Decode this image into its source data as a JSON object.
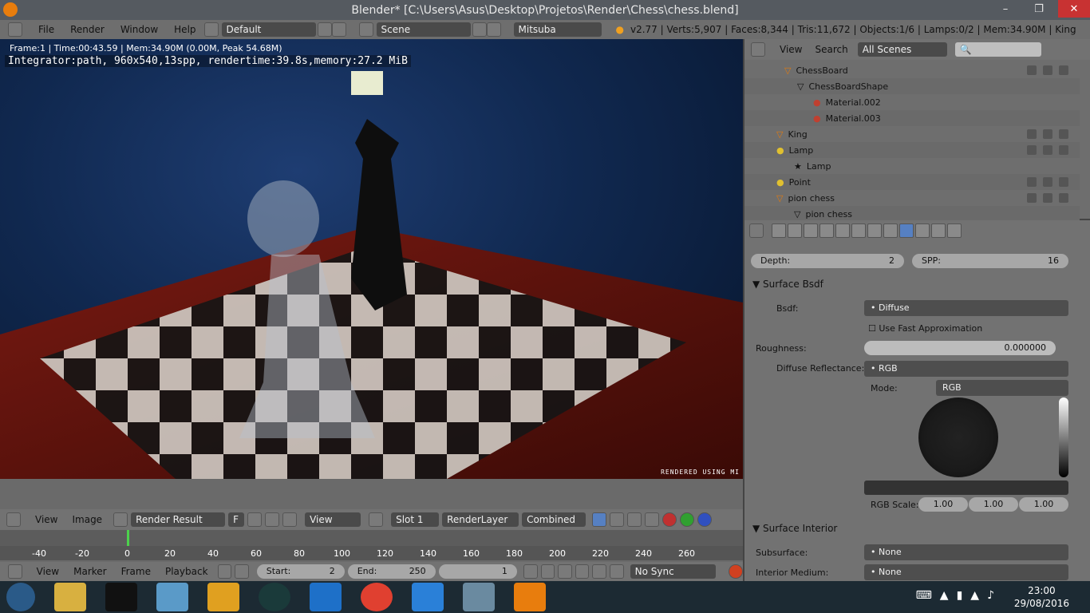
{
  "titlebar": {
    "title": "Blender* [C:\\Users\\Asus\\Desktop\\Projetos\\Render\\Chess\\chess.blend]",
    "minimize": "–",
    "restore": "❐",
    "close": "✕"
  },
  "infobar": {
    "menus": [
      "File",
      "Render",
      "Window",
      "Help"
    ],
    "layout": "Default",
    "scene": "Scene",
    "engine": "Mitsuba",
    "stats": "v2.77 | Verts:5,907 | Faces:8,344 | Tris:11,672 | Objects:1/6 | Lamps:0/2 | Mem:34.90M | King"
  },
  "viewport": {
    "frame_info": "Frame:1 | Time:00:43.59 | Mem:34.90M (0.00M, Peak 54.68M)",
    "integrator": "Integrator:path, 960x540,13spp, rendertime:39.8s,memory:27.2 MiB",
    "footer": "RENDERED USING MI"
  },
  "imagebar": {
    "view": "View",
    "image": "Image",
    "render_result": "Render Result",
    "f_label": "F",
    "view2": "View",
    "slot": "Slot 1",
    "layer": "RenderLayer",
    "pass": "Combined"
  },
  "timeline": {
    "ticks": [
      "-40",
      "-20",
      "0",
      "20",
      "40",
      "60",
      "80",
      "100",
      "120",
      "140",
      "160",
      "180",
      "200",
      "220",
      "240",
      "260"
    ],
    "menus": [
      "View",
      "Marker",
      "Frame",
      "Playback"
    ],
    "start_label": "Start:",
    "start_value": "2",
    "end_label": "End:",
    "end_value": "250",
    "current": "1",
    "sync": "No Sync"
  },
  "outliner": {
    "view": "View",
    "search": "Search",
    "filter": "All Scenes",
    "rows": [
      {
        "label": "ChessBoard"
      },
      {
        "label": "ChessBoardShape"
      },
      {
        "label": "Material.002"
      },
      {
        "label": "Material.003"
      },
      {
        "label": "King"
      },
      {
        "label": "Lamp"
      },
      {
        "label": "Lamp"
      },
      {
        "label": "Point"
      },
      {
        "label": "pion chess"
      },
      {
        "label": "pion chess"
      }
    ]
  },
  "properties": {
    "depth_label": "Depth:",
    "depth_value": "2",
    "spp_label": "SPP:",
    "spp_value": "16",
    "surface_bsdf": "Surface Bsdf",
    "bsdf_label": "Bsdf:",
    "bsdf_value": "Diffuse",
    "fast_approx": "Use Fast Approximation",
    "roughness_label": "Roughness:",
    "roughness_value": "0.000000",
    "diffuse_label": "Diffuse Reflectance:",
    "diffuse_value": "RGB",
    "mode_label": "Mode:",
    "mode_value": "RGB",
    "rgb_scale_label": "RGB Scale:",
    "rgb_scale": [
      "1.00",
      "1.00",
      "1.00"
    ],
    "surface_interior": "Surface Interior",
    "subsurface_label": "Subsurface:",
    "subsurface_value": "None",
    "interior_label": "Interior Medium:",
    "interior_value": "None"
  },
  "taskbar": {
    "time": "23:00",
    "date": "29/08/2016"
  }
}
